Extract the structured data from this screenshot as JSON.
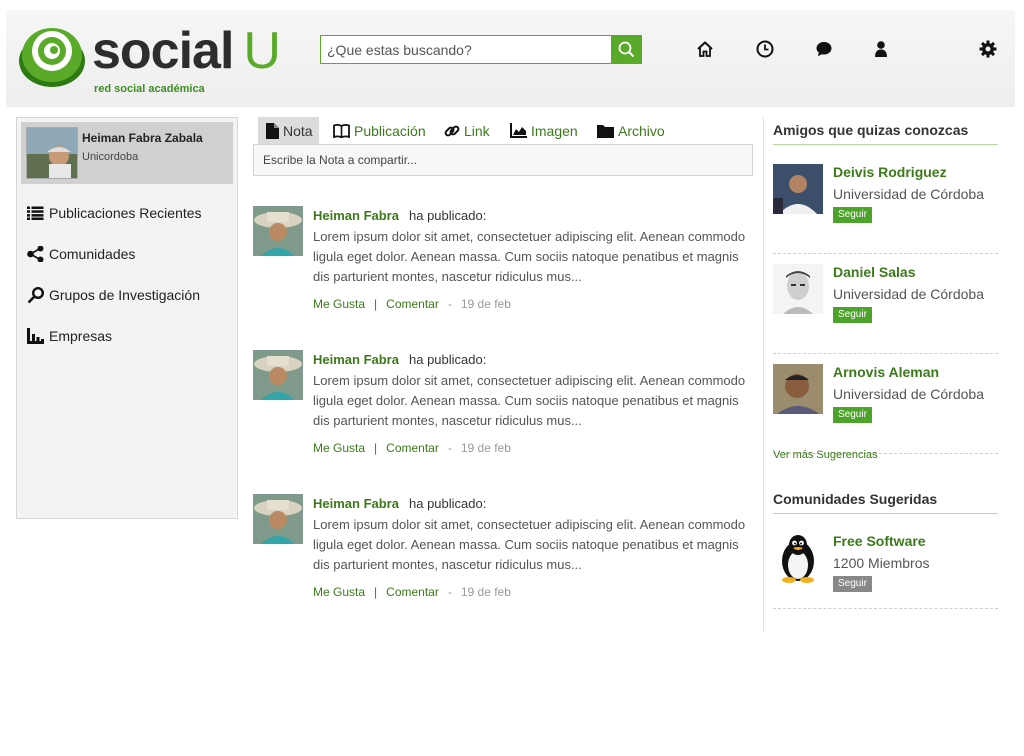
{
  "app": {
    "logo_word": "social",
    "logo_u": "U",
    "logo_tagline": "red social académica"
  },
  "search": {
    "placeholder": "¿Que estas buscando?"
  },
  "nav_icons": [
    "home-icon",
    "clock-icon",
    "chat-icon",
    "user-icon",
    "gear-icon"
  ],
  "colors": {
    "accent": "#5aaa2a",
    "link": "#3c7a1a",
    "follow_button": "#4ca42a",
    "follow_button_muted": "#888888"
  },
  "profile": {
    "name": "Heiman Fabra Zabala",
    "university": "Unicordoba"
  },
  "sidebar": {
    "items": [
      {
        "label": "Publicaciones Recientes",
        "icon": "list-icon"
      },
      {
        "label": "Comunidades",
        "icon": "share-icon"
      },
      {
        "label": "Grupos de Investigación",
        "icon": "key-icon"
      },
      {
        "label": "Empresas",
        "icon": "bar-chart-icon"
      }
    ]
  },
  "composer": {
    "tabs": [
      {
        "label": "Nota",
        "icon": "file-icon",
        "active": true
      },
      {
        "label": "Publicación",
        "icon": "book-icon",
        "active": false
      },
      {
        "label": "Link",
        "icon": "link-icon",
        "active": false
      },
      {
        "label": "Imagen",
        "icon": "area-chart-icon",
        "active": false
      },
      {
        "label": "Archivo",
        "icon": "folder-icon",
        "active": false
      }
    ],
    "placeholder": "Escribe la Nota a compartir..."
  },
  "feed": {
    "posts": [
      {
        "author": "Heiman Fabra",
        "action": "ha publicado:",
        "body": "Lorem ipsum dolor sit amet, consectetuer adipiscing elit. Aenean commodo ligula eget dolor. Aenean massa. Cum sociis natoque penatibus et magnis dis parturient montes, nascetur ridiculus mus...",
        "like": "Me Gusta",
        "sep": "|",
        "comment": "Comentar",
        "dash": "-",
        "date": "19 de feb"
      },
      {
        "author": "Heiman Fabra",
        "action": "ha publicado:",
        "body": "Lorem ipsum dolor sit amet, consectetuer adipiscing elit. Aenean commodo ligula eget dolor. Aenean massa. Cum sociis natoque penatibus et magnis dis parturient montes, nascetur ridiculus mus...",
        "like": "Me Gusta",
        "sep": "|",
        "comment": "Comentar",
        "dash": "-",
        "date": "19 de feb"
      },
      {
        "author": "Heiman Fabra",
        "action": "ha publicado:",
        "body": "Lorem ipsum dolor sit amet, consectetuer adipiscing elit. Aenean commodo ligula eget dolor. Aenean massa. Cum sociis natoque penatibus et magnis dis parturient montes, nascetur ridiculus mus...",
        "like": "Me Gusta",
        "sep": "|",
        "comment": "Comentar",
        "dash": "-",
        "date": "19 de feb"
      }
    ]
  },
  "friends": {
    "title": "Amigos que quizas conozcas",
    "items": [
      {
        "name": "Deivis Rodriguez",
        "university": "Universidad de Córdoba",
        "follow": "Seguir"
      },
      {
        "name": "Daniel Salas",
        "university": "Universidad de Córdoba",
        "follow": "Seguir"
      },
      {
        "name": "Arnovis Aleman",
        "university": "Universidad de Córdoba",
        "follow": "Seguir"
      }
    ],
    "more": "Ver más Sugerencias"
  },
  "communities": {
    "title": "Comunidades Sugeridas",
    "items": [
      {
        "name": "Free Software",
        "members": "1200 Miembros",
        "follow": "Seguir"
      }
    ]
  }
}
